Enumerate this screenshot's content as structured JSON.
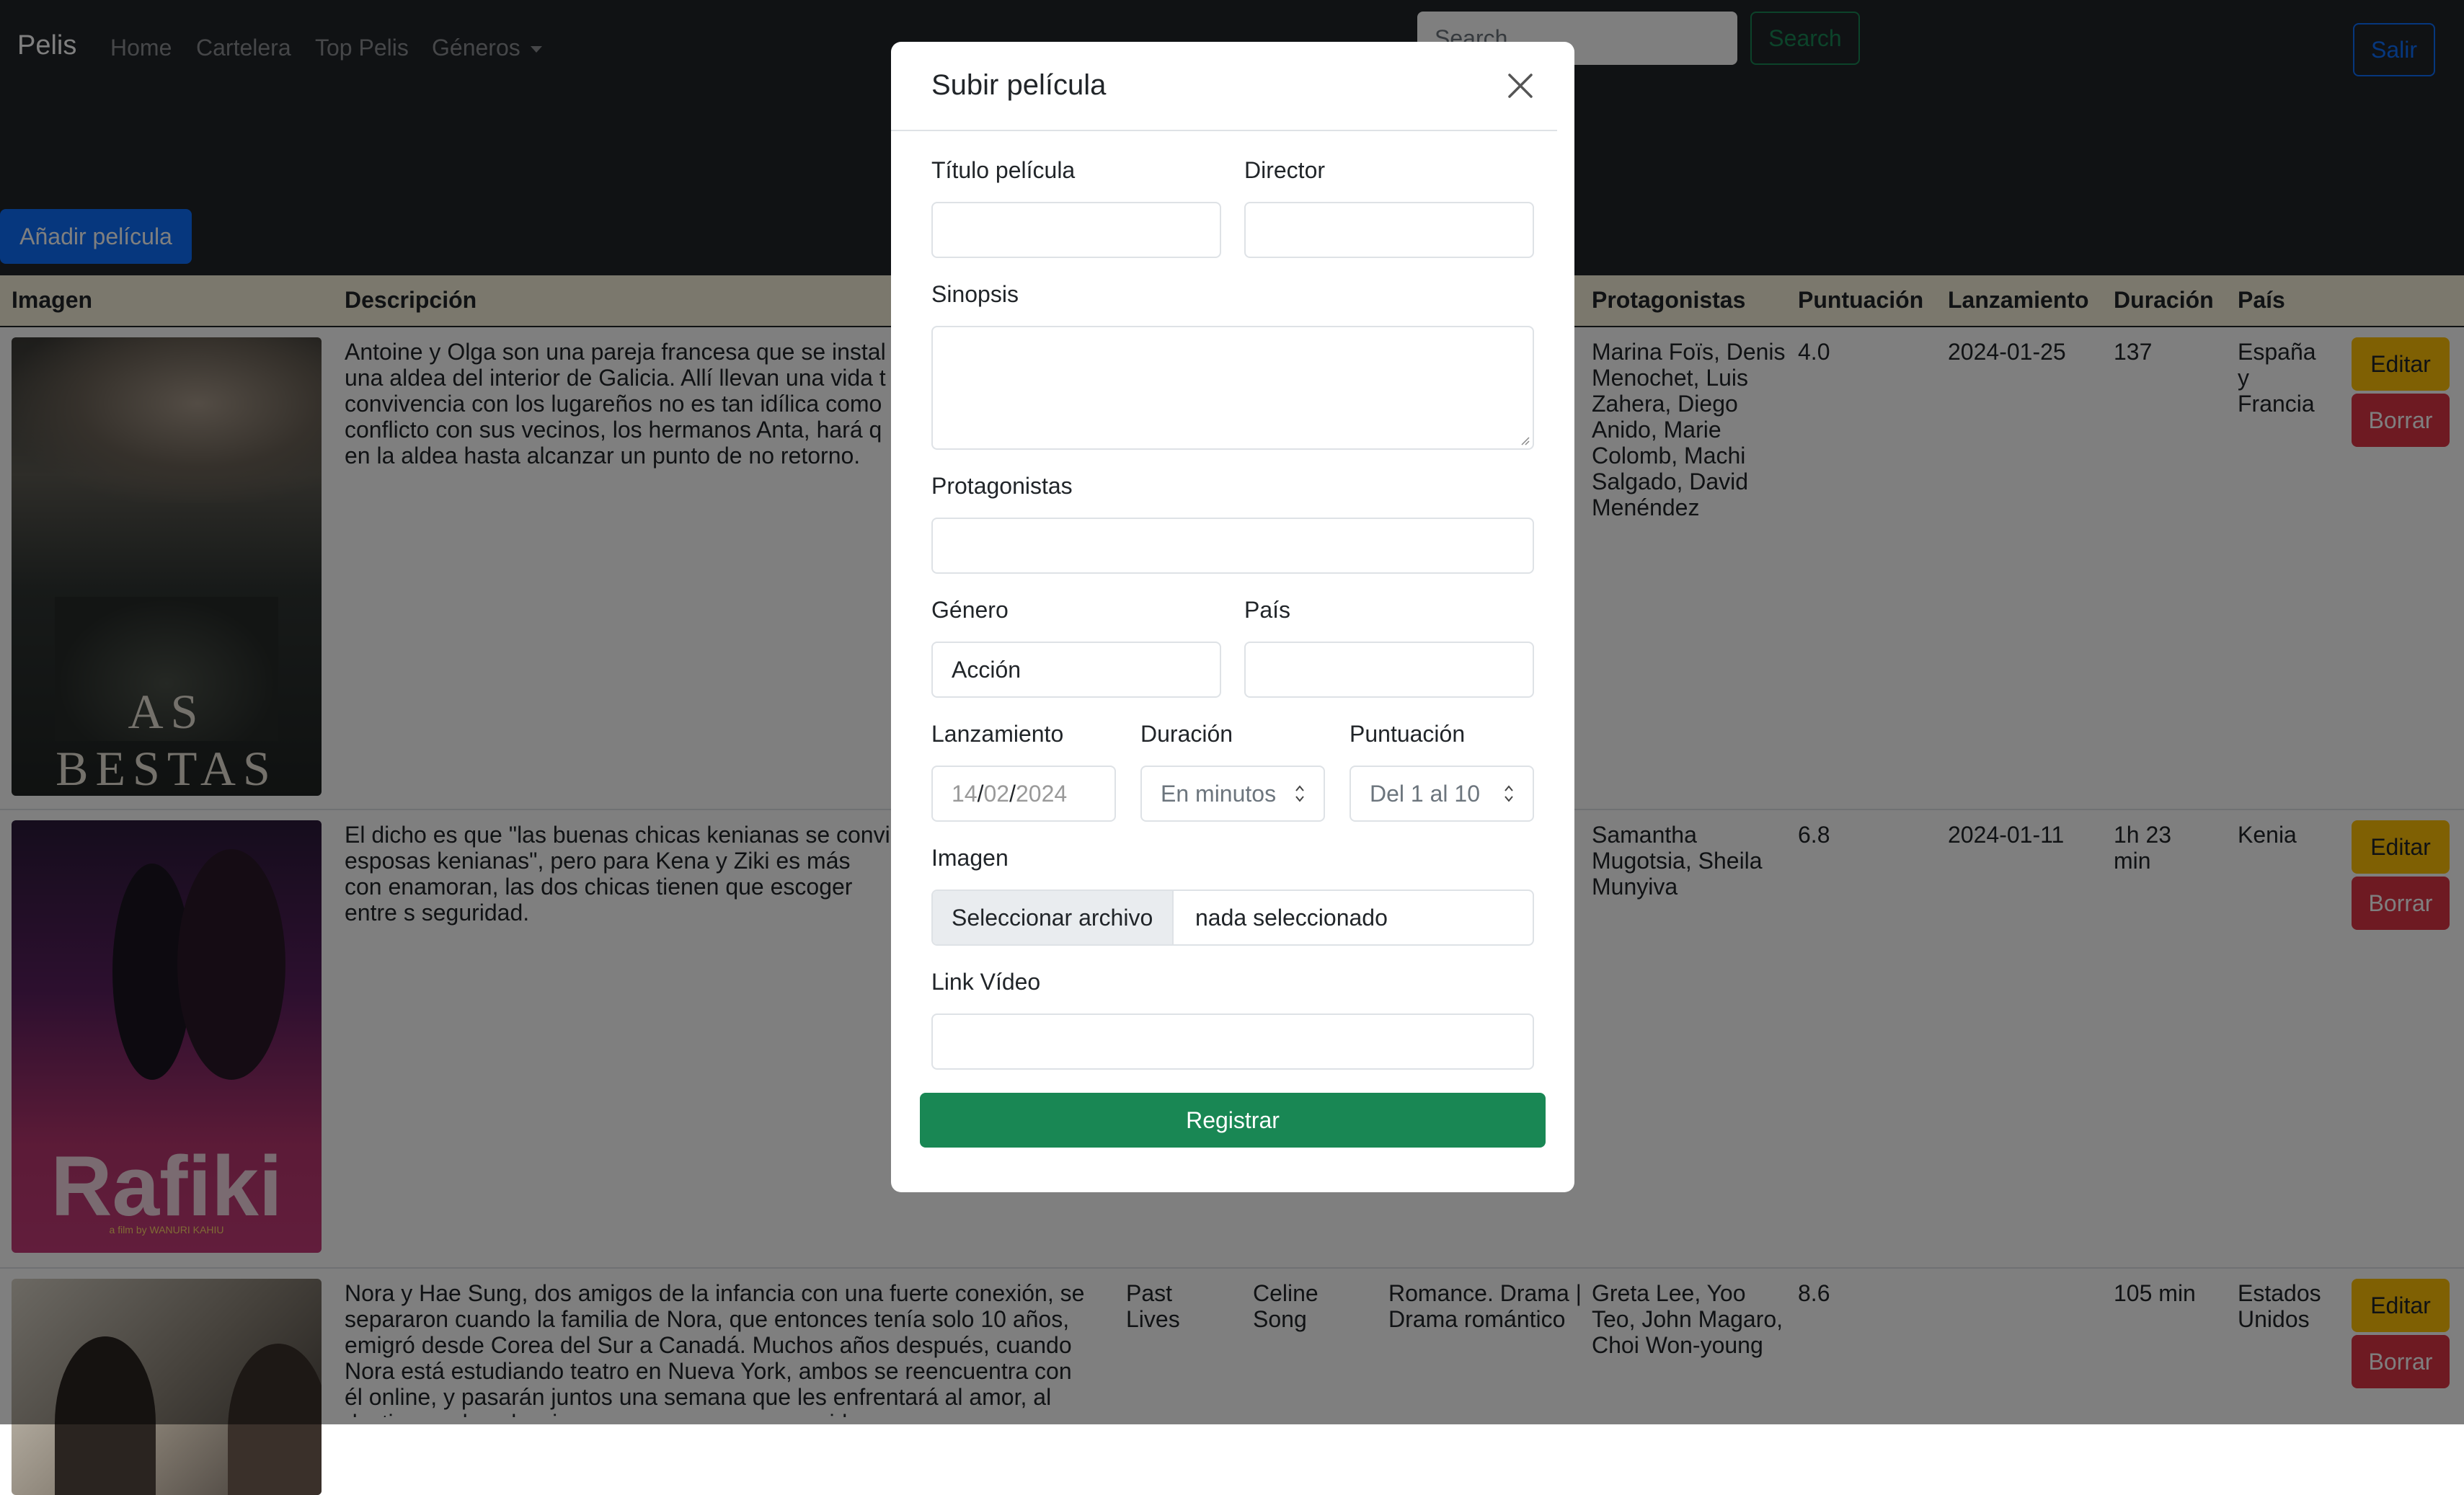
{
  "navbar": {
    "brand": "Pelis",
    "links": [
      "Home",
      "Cartelera",
      "Top Pelis",
      "Géneros"
    ],
    "search_placeholder": "Search",
    "search_button": "Search",
    "logout_button": "Salir"
  },
  "page": {
    "add_button": "Añadir película",
    "columns": [
      "Imagen",
      "Descripción",
      "Protagonistas",
      "Puntuación",
      "Lanzamiento",
      "Duración",
      "País"
    ],
    "rows": [
      {
        "poster_text": "AS BESTAS",
        "description": "Antoine y Olga son una pareja francesa que se instal una aldea del interior de Galicia. Allí llevan una vida t convivencia con los lugareños no es tan idílica como conflicto con sus vecinos, los hermanos Anta, hará q en la aldea hasta alcanzar un punto de no retorno.",
        "cast": "Marina Foïs, Denis Menochet, Luis Zahera, Diego Anido, Marie Colomb, Machi Salgado, David Menéndez",
        "score": "4.0",
        "release": "2024-01-25",
        "duration": "137",
        "country": "España y Francia"
      },
      {
        "poster_text": "Rafiki",
        "poster_subtext": "a film by WANURI KAHIU",
        "description": "El dicho es que \"las buenas chicas kenianas se convi esposas kenianas\", pero para Kena y Ziki es más con enamoran, las dos chicas tienen que escoger entre s seguridad.",
        "cast": "Samantha Mugotsia, Sheila Munyiva",
        "score": "6.8",
        "release": "2024-01-11",
        "duration": "1h 23 min",
        "country": "Kenia"
      },
      {
        "description": "Nora y Hae Sung, dos amigos de la infancia con una fuerte conexión, se separaron cuando la familia de Nora, que entonces tenía solo 10 años, emigró desde Corea del Sur a Canadá. Muchos años después, cuando Nora está estudiando teatro en Nueva York, ambos se reencuentra con él online, y pasarán juntos una semana que les enfrentará al amor, al destino y a las elecciones que componen una vida.",
        "title": "Past Lives",
        "director": "Celine Song",
        "genre": "Romance. Drama | Drama romántico",
        "cast": "Greta Lee, Yoo Teo, John Magaro, Choi Won-young",
        "score": "8.6",
        "release": "",
        "duration": "105 min",
        "country": "Estados Unidos"
      }
    ],
    "edit_label": "Editar",
    "delete_label": "Borrar"
  },
  "modal": {
    "title": "Subir película",
    "labels": {
      "title": "Título película",
      "director": "Director",
      "synopsis": "Sinopsis",
      "cast": "Protagonistas",
      "genre": "Género",
      "country": "País",
      "release": "Lanzamiento",
      "duration": "Duración",
      "score": "Puntuación",
      "image": "Imagen",
      "video": "Link Vídeo"
    },
    "genre_value": "Acción",
    "date_day": "14",
    "date_month": "02",
    "date_year": "2024",
    "duration_placeholder": "En minutos",
    "score_placeholder": "Del 1 al 10",
    "file_button": "Seleccionar archivo",
    "file_status": "nada seleccionado",
    "submit": "Registrar"
  },
  "colors": {
    "navbar_bg": "#212529",
    "primary": "#0d6efd",
    "success": "#198754",
    "warning": "#ffc107",
    "danger": "#dc3545",
    "table_header_bg": "#f7f1db"
  }
}
